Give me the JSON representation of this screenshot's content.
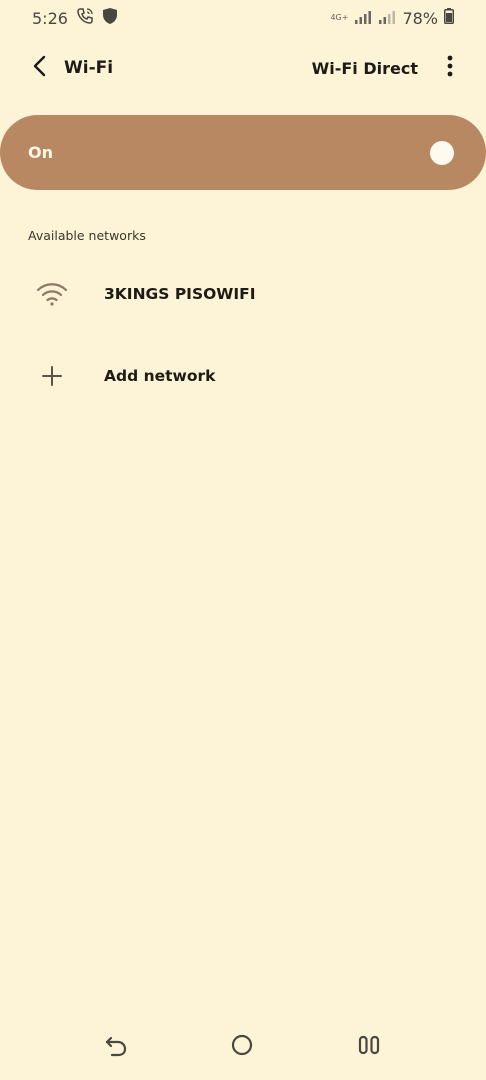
{
  "status_bar": {
    "time": "5:26",
    "network_type": "4G+",
    "battery_percent": "78%",
    "icons": [
      "wifi-calling-icon",
      "shield-icon",
      "signal-icon",
      "signal-icon",
      "battery-icon"
    ]
  },
  "header": {
    "title": "Wi-Fi",
    "action_label": "Wi-Fi Direct",
    "icons": [
      "back-arrow-icon",
      "more-options-icon"
    ]
  },
  "toggle": {
    "label": "On",
    "state": true
  },
  "networks": {
    "section_title": "Available networks",
    "items": [
      {
        "name": "3KINGS PISOWIFI",
        "icon": "wifi-icon"
      }
    ],
    "add_label": "Add network",
    "add_icon": "plus-icon"
  },
  "nav_bar": {
    "icons": [
      "back-nav-icon",
      "home-nav-icon",
      "recents-nav-icon"
    ]
  },
  "colors": {
    "background": "#fdf3d6",
    "toggle_card": "#b78862",
    "text": "#1d1b16"
  }
}
